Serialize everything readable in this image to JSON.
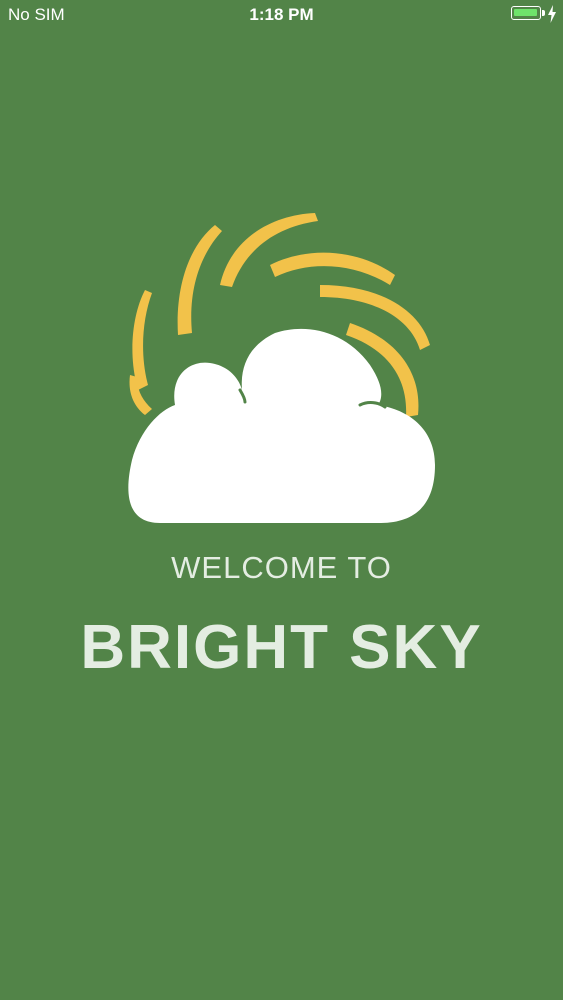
{
  "status_bar": {
    "carrier": "No SIM",
    "time": "1:18 PM",
    "battery_level": 1.0,
    "charging": true
  },
  "splash": {
    "welcome_label": "WELCOME TO",
    "app_name": "BRIGHT SKY"
  },
  "colors": {
    "background": "#528448",
    "sun_rays": "#f2c24a",
    "cloud": "#ffffff",
    "text": "#e4ede2",
    "battery_fill": "#6fe36b"
  },
  "icons": {
    "logo": "sun-behind-cloud-logo",
    "battery": "battery-icon",
    "charging": "charging-bolt-icon"
  }
}
